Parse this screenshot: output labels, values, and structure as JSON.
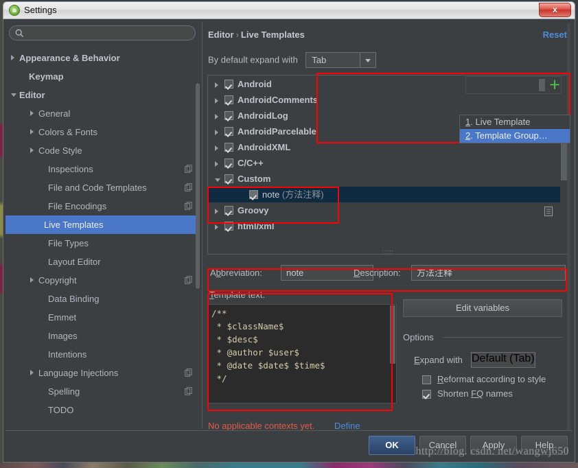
{
  "window": {
    "title": "Settings",
    "app_icon": "android-studio-icon",
    "close_label": "x"
  },
  "sidebar": {
    "search": {
      "value": "",
      "placeholder": "",
      "icon": "search-icon"
    },
    "items": [
      {
        "label": "Appearance & Behavior",
        "arrow": "right",
        "indent": 14,
        "bold": true,
        "selected": false,
        "copy": false
      },
      {
        "label": "Keymap",
        "arrow": "none",
        "indent": 28,
        "bold": true,
        "selected": false,
        "copy": false
      },
      {
        "label": "Editor",
        "arrow": "down",
        "indent": 14,
        "bold": true,
        "selected": false,
        "copy": false
      },
      {
        "label": "General",
        "arrow": "right",
        "indent": 42,
        "bold": false,
        "selected": false,
        "copy": false
      },
      {
        "label": "Colors & Fonts",
        "arrow": "right",
        "indent": 42,
        "bold": false,
        "selected": false,
        "copy": false
      },
      {
        "label": "Code Style",
        "arrow": "right",
        "indent": 42,
        "bold": false,
        "selected": false,
        "copy": false
      },
      {
        "label": "Inspections",
        "arrow": "none",
        "indent": 56,
        "bold": false,
        "selected": false,
        "copy": true
      },
      {
        "label": "File and Code Templates",
        "arrow": "none",
        "indent": 56,
        "bold": false,
        "selected": false,
        "copy": true
      },
      {
        "label": "File Encodings",
        "arrow": "none",
        "indent": 56,
        "bold": false,
        "selected": false,
        "copy": true
      },
      {
        "label": "Live Templates",
        "arrow": "none",
        "indent": 56,
        "bold": false,
        "selected": true,
        "copy": false
      },
      {
        "label": "File Types",
        "arrow": "none",
        "indent": 56,
        "bold": false,
        "selected": false,
        "copy": false
      },
      {
        "label": "Layout Editor",
        "arrow": "none",
        "indent": 56,
        "bold": false,
        "selected": false,
        "copy": false
      },
      {
        "label": "Copyright",
        "arrow": "right",
        "indent": 42,
        "bold": false,
        "selected": false,
        "copy": true
      },
      {
        "label": "Data Binding",
        "arrow": "none",
        "indent": 56,
        "bold": false,
        "selected": false,
        "copy": false
      },
      {
        "label": "Emmet",
        "arrow": "none",
        "indent": 56,
        "bold": false,
        "selected": false,
        "copy": false
      },
      {
        "label": "Images",
        "arrow": "none",
        "indent": 56,
        "bold": false,
        "selected": false,
        "copy": false
      },
      {
        "label": "Intentions",
        "arrow": "none",
        "indent": 56,
        "bold": false,
        "selected": false,
        "copy": false
      },
      {
        "label": "Language Injections",
        "arrow": "right",
        "indent": 42,
        "bold": false,
        "selected": false,
        "copy": true
      },
      {
        "label": "Spelling",
        "arrow": "none",
        "indent": 56,
        "bold": false,
        "selected": false,
        "copy": true
      },
      {
        "label": "TODO",
        "arrow": "none",
        "indent": 56,
        "bold": false,
        "selected": false,
        "copy": false
      }
    ]
  },
  "content": {
    "breadcrumb_parent": "Editor",
    "breadcrumb_sep": "›",
    "breadcrumb_current": "Live Templates",
    "reset_label": "Reset",
    "expand_with_label": "By default expand with",
    "expand_with_value": "Tab",
    "templates": [
      {
        "label": "Android",
        "child": false,
        "arrow": "right",
        "selected": false
      },
      {
        "label": "AndroidComments",
        "child": false,
        "arrow": "right",
        "selected": false
      },
      {
        "label": "AndroidLog",
        "child": false,
        "arrow": "right",
        "selected": false
      },
      {
        "label": "AndroidParcelable",
        "child": false,
        "arrow": "right",
        "selected": false
      },
      {
        "label": "AndroidXML",
        "child": false,
        "arrow": "right",
        "selected": false
      },
      {
        "label": "C/C++",
        "child": false,
        "arrow": "right",
        "selected": false
      },
      {
        "label": "Custom",
        "child": false,
        "arrow": "down",
        "selected": false
      },
      {
        "label": "note",
        "child": true,
        "arrow": "none",
        "selected": true,
        "suffix": "(方法注释)"
      },
      {
        "label": "Groovy",
        "child": false,
        "arrow": "right",
        "selected": false
      },
      {
        "label": "html/xml",
        "child": false,
        "arrow": "right",
        "selected": false
      }
    ],
    "add_button": "+",
    "dropdown": {
      "items": [
        {
          "num": "1",
          "label": ". Live Template",
          "highlighted": false
        },
        {
          "num": "2",
          "label": ". Template Group…",
          "highlighted": true
        }
      ]
    },
    "abbreviation_label_pre": "A",
    "abbreviation_label_key": "b",
    "abbreviation_label_post": "breviation:",
    "abbreviation_value": "note",
    "description_label_key": "D",
    "description_label_post": "escription:",
    "description_value": "方法注释",
    "template_text_label_key": "T",
    "template_text_label_post": "emplate text:",
    "template_text": "/**\n * $className$\n * $desc$\n * @author $user$\n * @date $date$ $time$\n */",
    "edit_variables_label": "Edit variables",
    "options_title": "Options",
    "expand_with_opt_label_key": "E",
    "expand_with_opt_label_post": "xpand with",
    "expand_with_opt_value": "Default (Tab)",
    "reformat_label_pre": "",
    "reformat_label_key": "R",
    "reformat_label_post": "eformat according to style",
    "reformat_checked": false,
    "shorten_label_pre": "Shorten ",
    "shorten_label_key": "FQ",
    "shorten_label_post": " names",
    "shorten_checked": true,
    "context_warning": "No applicable contexts yet.",
    "context_define": "Define"
  },
  "buttons": [
    {
      "label": "OK",
      "default": true
    },
    {
      "label": "Cancel",
      "default": false
    },
    {
      "label": "Apply",
      "default": false
    },
    {
      "label": "Help",
      "default": false
    }
  ],
  "watermark": "http://blog. csdn. net/wangwj650",
  "colors": {
    "accent_blue": "#4a77c7",
    "link_blue": "#4f8ddb",
    "warning_red": "#e05c4a",
    "annotation_red": "#fd0000",
    "plus_green": "#4ec94e",
    "panel_bg": "#3c3f41",
    "editor_bg": "#2b2b2b",
    "selected_row_bg": "#0f2b41"
  }
}
